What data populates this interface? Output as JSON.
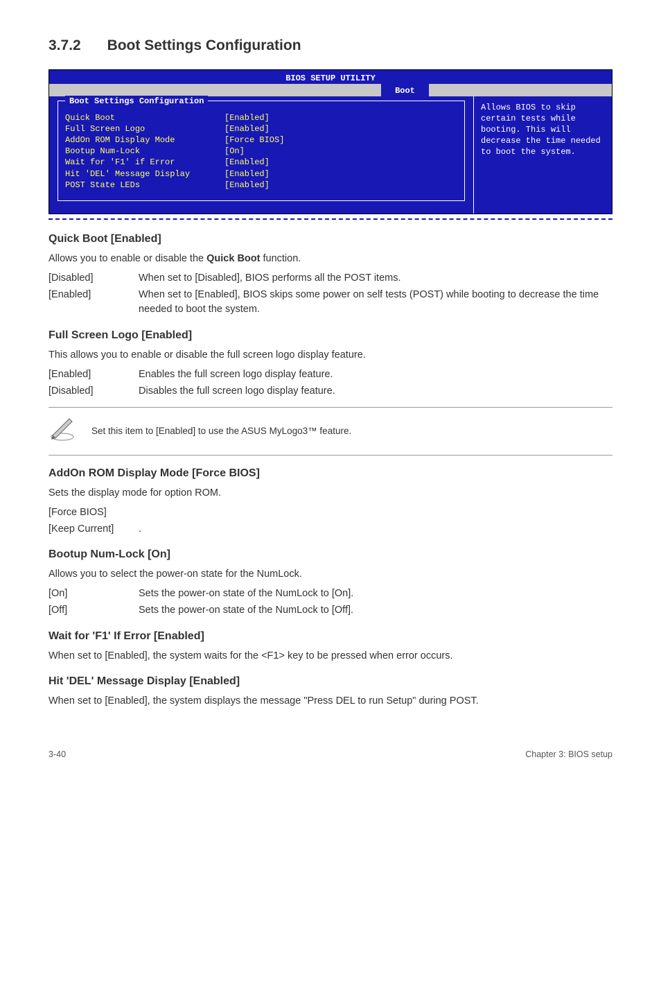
{
  "section": {
    "number": "3.7.2",
    "title": "Boot Settings Configuration"
  },
  "bios": {
    "header": "BIOS SETUP UTILITY",
    "tab": "Boot",
    "panel_title": "Boot Settings Configuration",
    "rows": [
      {
        "label": "Quick Boot",
        "value": "[Enabled]"
      },
      {
        "label": "Full Screen Logo",
        "value": "[Enabled]"
      },
      {
        "label": "AddOn ROM Display Mode",
        "value": "[Force BIOS]"
      },
      {
        "label": "Bootup Num-Lock",
        "value": "[On]"
      },
      {
        "label": "Wait for 'F1' if Error",
        "value": "[Enabled]"
      },
      {
        "label": "Hit 'DEL' Message Display",
        "value": "[Enabled]"
      },
      {
        "label": "POST State LEDs",
        "value": "[Enabled]"
      }
    ],
    "help": "Allows BIOS to skip certain tests while booting. This will decrease the time needed to boot the system."
  },
  "quickboot": {
    "heading": "Quick Boot [Enabled]",
    "intro_pre": "Allows you to enable or disable the ",
    "intro_bold": "Quick Boot",
    "intro_post": " function.",
    "rows": [
      {
        "term": "[Disabled]",
        "desc": "When set to [Disabled], BIOS performs all the POST items."
      },
      {
        "term": "[Enabled]",
        "desc": "When set to [Enabled], BIOS skips some power on self tests (POST) while booting to decrease the time needed to boot the system."
      }
    ]
  },
  "fullscreen": {
    "heading": "Full Screen Logo [Enabled]",
    "intro": "This allows you to enable or disable the full screen logo display feature.",
    "rows": [
      {
        "term": "[Enabled]",
        "desc": "Enables the full screen logo display feature."
      },
      {
        "term": "[Disabled]",
        "desc": "Disables the full screen logo display feature."
      }
    ]
  },
  "note": {
    "text": "Set this item to [Enabled] to use the ASUS MyLogo3™ feature."
  },
  "addon": {
    "heading": "AddOn ROM Display Mode [Force BIOS]",
    "intro": "Sets the display mode for option ROM.",
    "rows": [
      {
        "term": "[Force BIOS]",
        "desc": ""
      },
      {
        "term": "[Keep Current]",
        "desc": "."
      }
    ]
  },
  "numlock": {
    "heading": "Bootup Num-Lock [On]",
    "intro": "Allows you to select the power-on state for the NumLock.",
    "rows": [
      {
        "term": "[On]",
        "desc": "Sets the power-on state of the NumLock to [On]."
      },
      {
        "term": "[Off]",
        "desc": "Sets the power-on state of the NumLock to [Off]."
      }
    ]
  },
  "waitf1": {
    "heading": "Wait for 'F1' If Error [Enabled]",
    "body": "When set to [Enabled], the system waits for the <F1> key to be pressed when error occurs."
  },
  "hitdel": {
    "heading": "Hit 'DEL' Message Display [Enabled]",
    "body": "When set to [Enabled], the system displays the message \"Press DEL to run Setup\" during POST."
  },
  "footer": {
    "left": "3-40",
    "right": "Chapter 3: BIOS setup"
  },
  "chart_data": null
}
